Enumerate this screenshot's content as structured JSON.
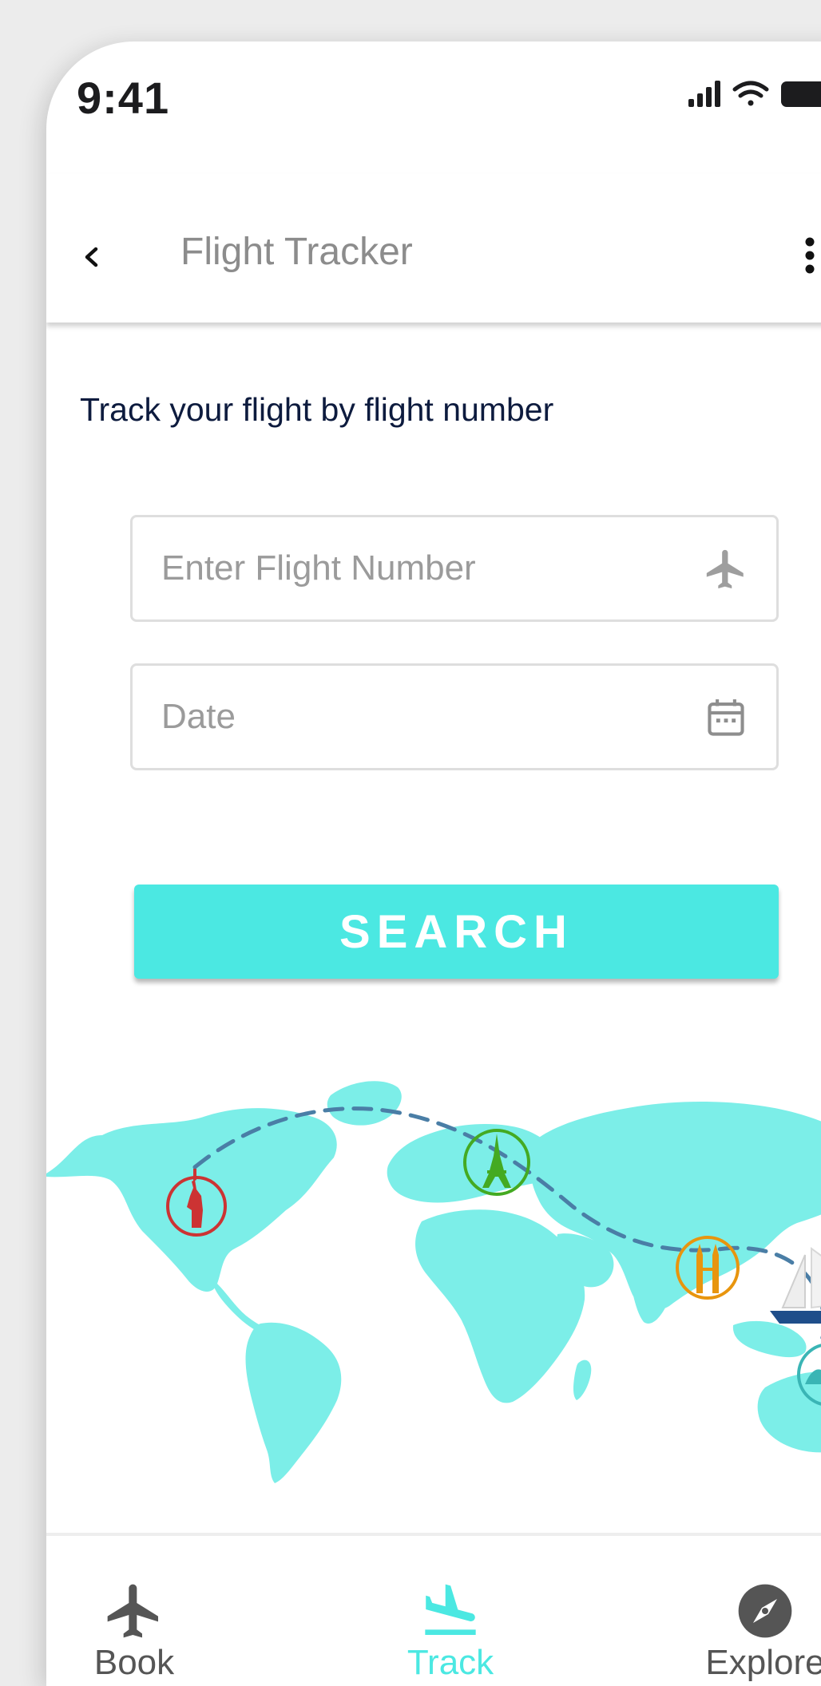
{
  "status_bar": {
    "time": "9:41"
  },
  "header": {
    "title": "Flight Tracker",
    "back_icon": "chevron-left-icon",
    "more_icon": "more-vertical-icon"
  },
  "main": {
    "subtitle": "Track your flight by flight number",
    "flight_number_field": {
      "value": "",
      "placeholder": "Enter Flight Number",
      "icon": "airplane-icon"
    },
    "date_field": {
      "value": "",
      "placeholder": "Date",
      "icon": "calendar-icon"
    },
    "search_label": "SEARCH"
  },
  "colors": {
    "accent": "#4be8e2",
    "map_land": "#7ceee8",
    "route_line": "#4a7ea6",
    "marker_statue": "#cc3333",
    "marker_tower": "#44aa22",
    "marker_towers": "#e8950e",
    "marker_opera": "#3ab5b5",
    "title_text": "#0d1b3e"
  },
  "bottom_nav": {
    "items": [
      {
        "label": "Book",
        "icon": "airplane-icon",
        "active": false
      },
      {
        "label": "Track",
        "icon": "airplane-landing-icon",
        "active": true
      },
      {
        "label": "Explore",
        "icon": "compass-icon",
        "active": false
      }
    ]
  }
}
